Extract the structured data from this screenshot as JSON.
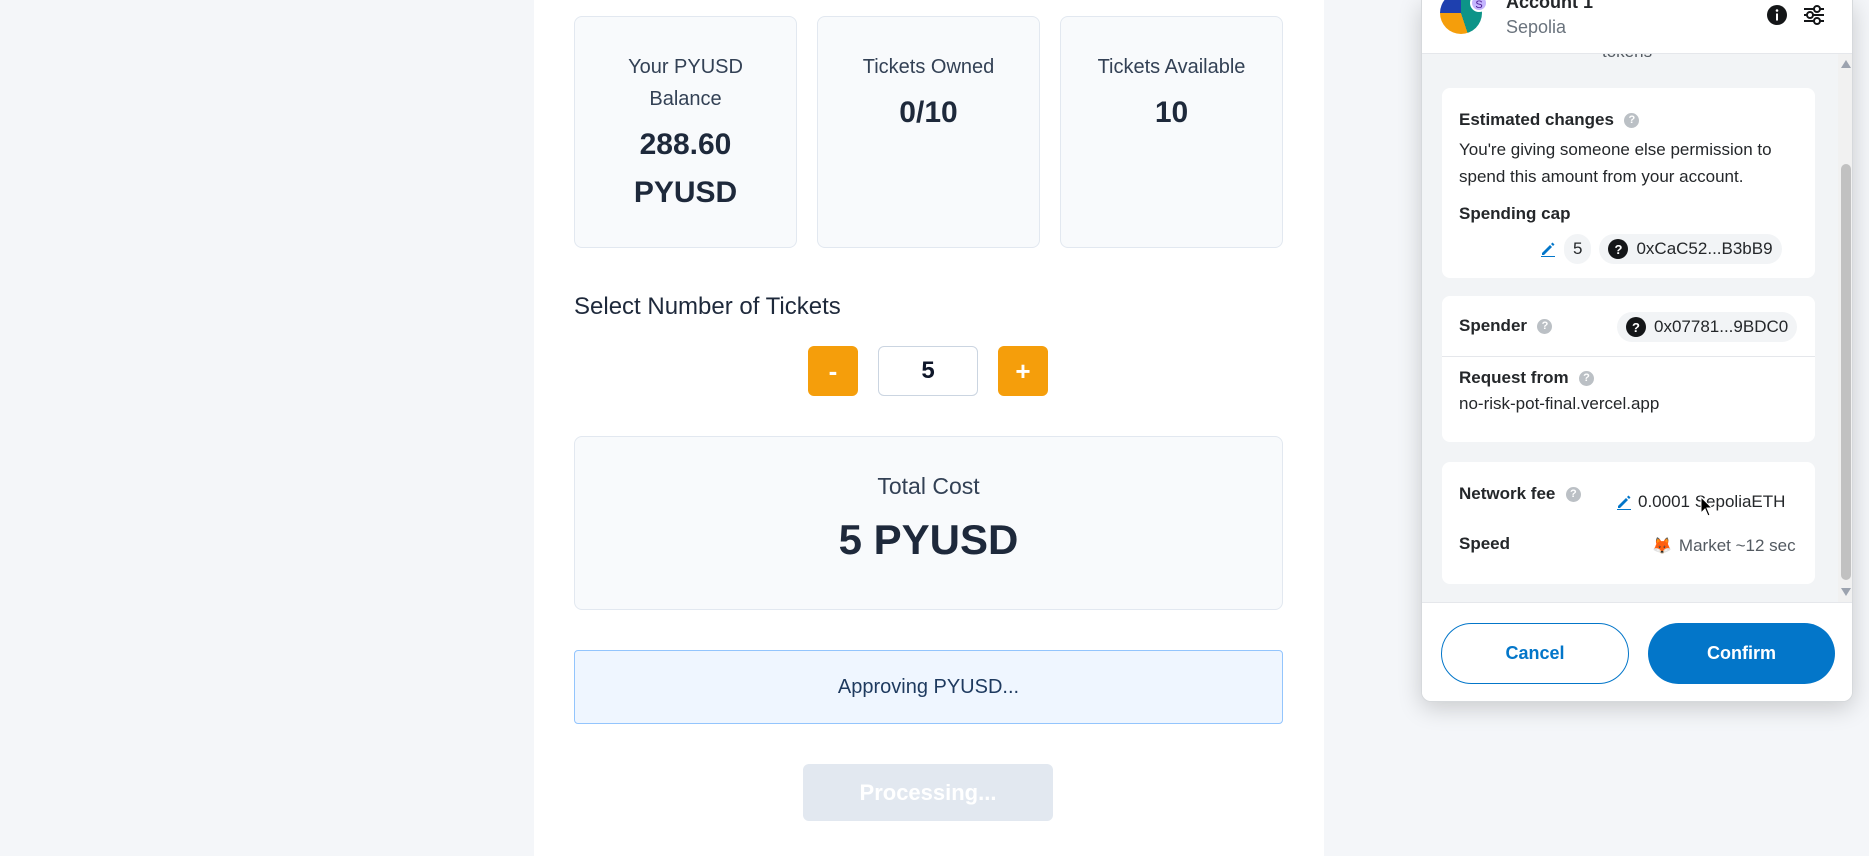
{
  "dapp": {
    "stats": {
      "balance": {
        "label": "Your PYUSD Balance",
        "value": "288.60 PYUSD"
      },
      "owned": {
        "label": "Tickets Owned",
        "value": "0/10"
      },
      "available": {
        "label": "Tickets Available",
        "value": "10"
      }
    },
    "select_title": "Select Number of Tickets",
    "stepper": {
      "minus": "-",
      "plus": "+",
      "quantity": "5"
    },
    "total": {
      "label": "Total Cost",
      "value": "5 PYUSD"
    },
    "status": "Approving PYUSD...",
    "process_button": "Processing..."
  },
  "metamask": {
    "account_name": "Account 1",
    "network_name": "Sepolia",
    "network_badge": "S",
    "tokens_cut": "tokens",
    "estimated_changes": {
      "title": "Estimated changes",
      "description": "You're giving someone else permission to spend this amount from your account.",
      "spending_cap_label": "Spending cap",
      "spending_cap_amount": "5",
      "token_address": "0xCaC52...B3bB9"
    },
    "spender": {
      "label": "Spender",
      "address": "0x07781...9BDC0"
    },
    "request_from": {
      "label": "Request from",
      "origin": "no-risk-pot-final.vercel.app"
    },
    "network_fee": {
      "label": "Network fee",
      "value": "0.0001 SepoliaETH"
    },
    "speed": {
      "label": "Speed",
      "value": "Market ~12 sec"
    },
    "cancel_label": "Cancel",
    "confirm_label": "Confirm"
  },
  "colors": {
    "accent_orange": "#f59e0b",
    "metamask_blue": "#0376c9",
    "status_bg": "#eff6ff",
    "status_border": "#93c5fd"
  },
  "icons": [
    "info-icon",
    "settings-sliders-icon",
    "help-icon",
    "edit-pencil-icon",
    "unknown-token-icon",
    "fox-icon",
    "cursor-icon"
  ]
}
